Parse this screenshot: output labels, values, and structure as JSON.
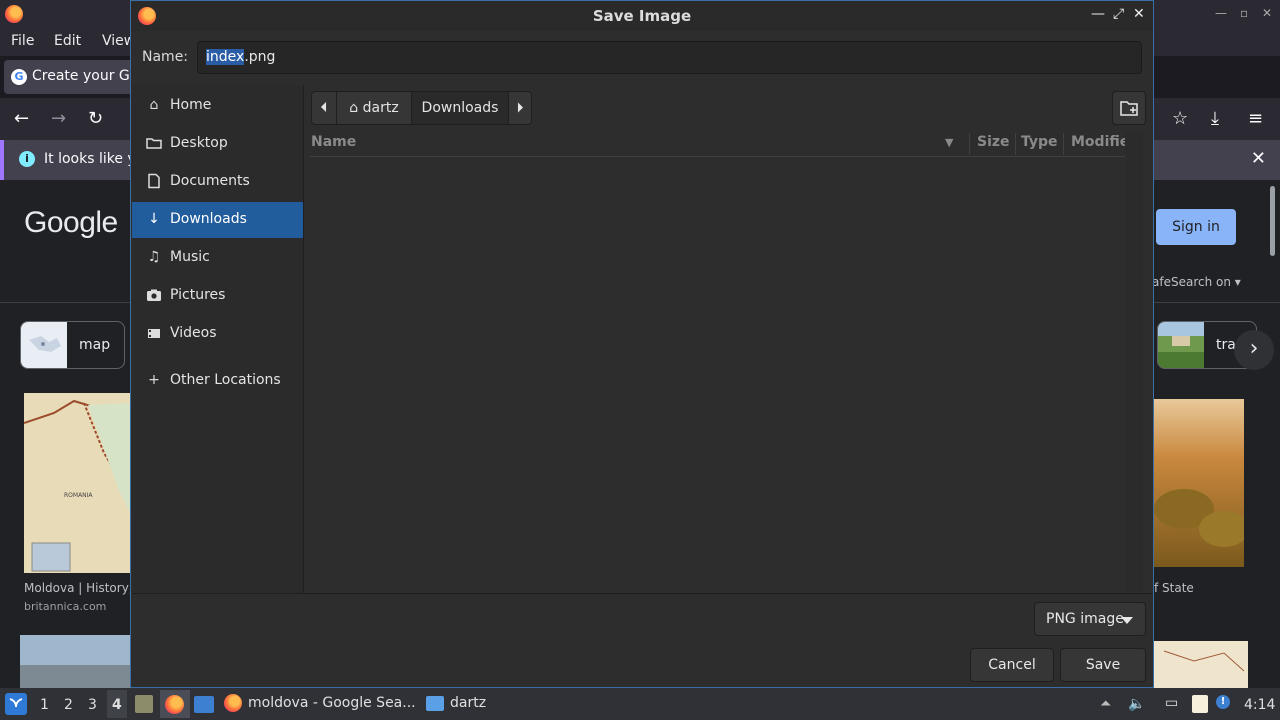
{
  "browser": {
    "menu": [
      "File",
      "Edit",
      "View"
    ],
    "tab_title": "Create your Go",
    "notification": "It looks like y",
    "google_logo": "Google",
    "signin": "Sign in",
    "safesearch": "afeSearch on ▾",
    "chips": [
      {
        "label": "map"
      },
      {
        "label": "tra"
      }
    ],
    "map_label": "ROMANIA",
    "results": [
      {
        "title": "Moldova | History, F",
        "source": "britannica.com"
      },
      {
        "title": "f State",
        "source": ""
      }
    ]
  },
  "dialog": {
    "title": "Save Image",
    "name_label": "Name:",
    "filename_selected": "index",
    "filename_rest": ".png",
    "places": [
      {
        "label": "Home",
        "icon": "home-icon"
      },
      {
        "label": "Desktop",
        "icon": "folder-icon"
      },
      {
        "label": "Documents",
        "icon": "document-icon"
      },
      {
        "label": "Downloads",
        "icon": "download-icon",
        "active": true
      },
      {
        "label": "Music",
        "icon": "music-icon"
      },
      {
        "label": "Pictures",
        "icon": "camera-icon"
      },
      {
        "label": "Videos",
        "icon": "video-icon"
      },
      {
        "label": "Other Locations",
        "icon": "plus-icon"
      }
    ],
    "path": [
      "dartz",
      "Downloads"
    ],
    "columns": {
      "name": "Name",
      "size": "Size",
      "type": "Type",
      "modified": "Modifie"
    },
    "filter": "PNG image",
    "cancel": "Cancel",
    "save": "Save"
  },
  "taskbar": {
    "workspaces": [
      "1",
      "2",
      "3",
      "4"
    ],
    "tasks": [
      {
        "label": "moldova - Google Sea..."
      },
      {
        "label": "dartz"
      }
    ],
    "clock": "4:14"
  },
  "colors": {
    "accent": "#215d9c",
    "selection": "#2a5da6",
    "dialog_bg": "#2d2d2d"
  }
}
